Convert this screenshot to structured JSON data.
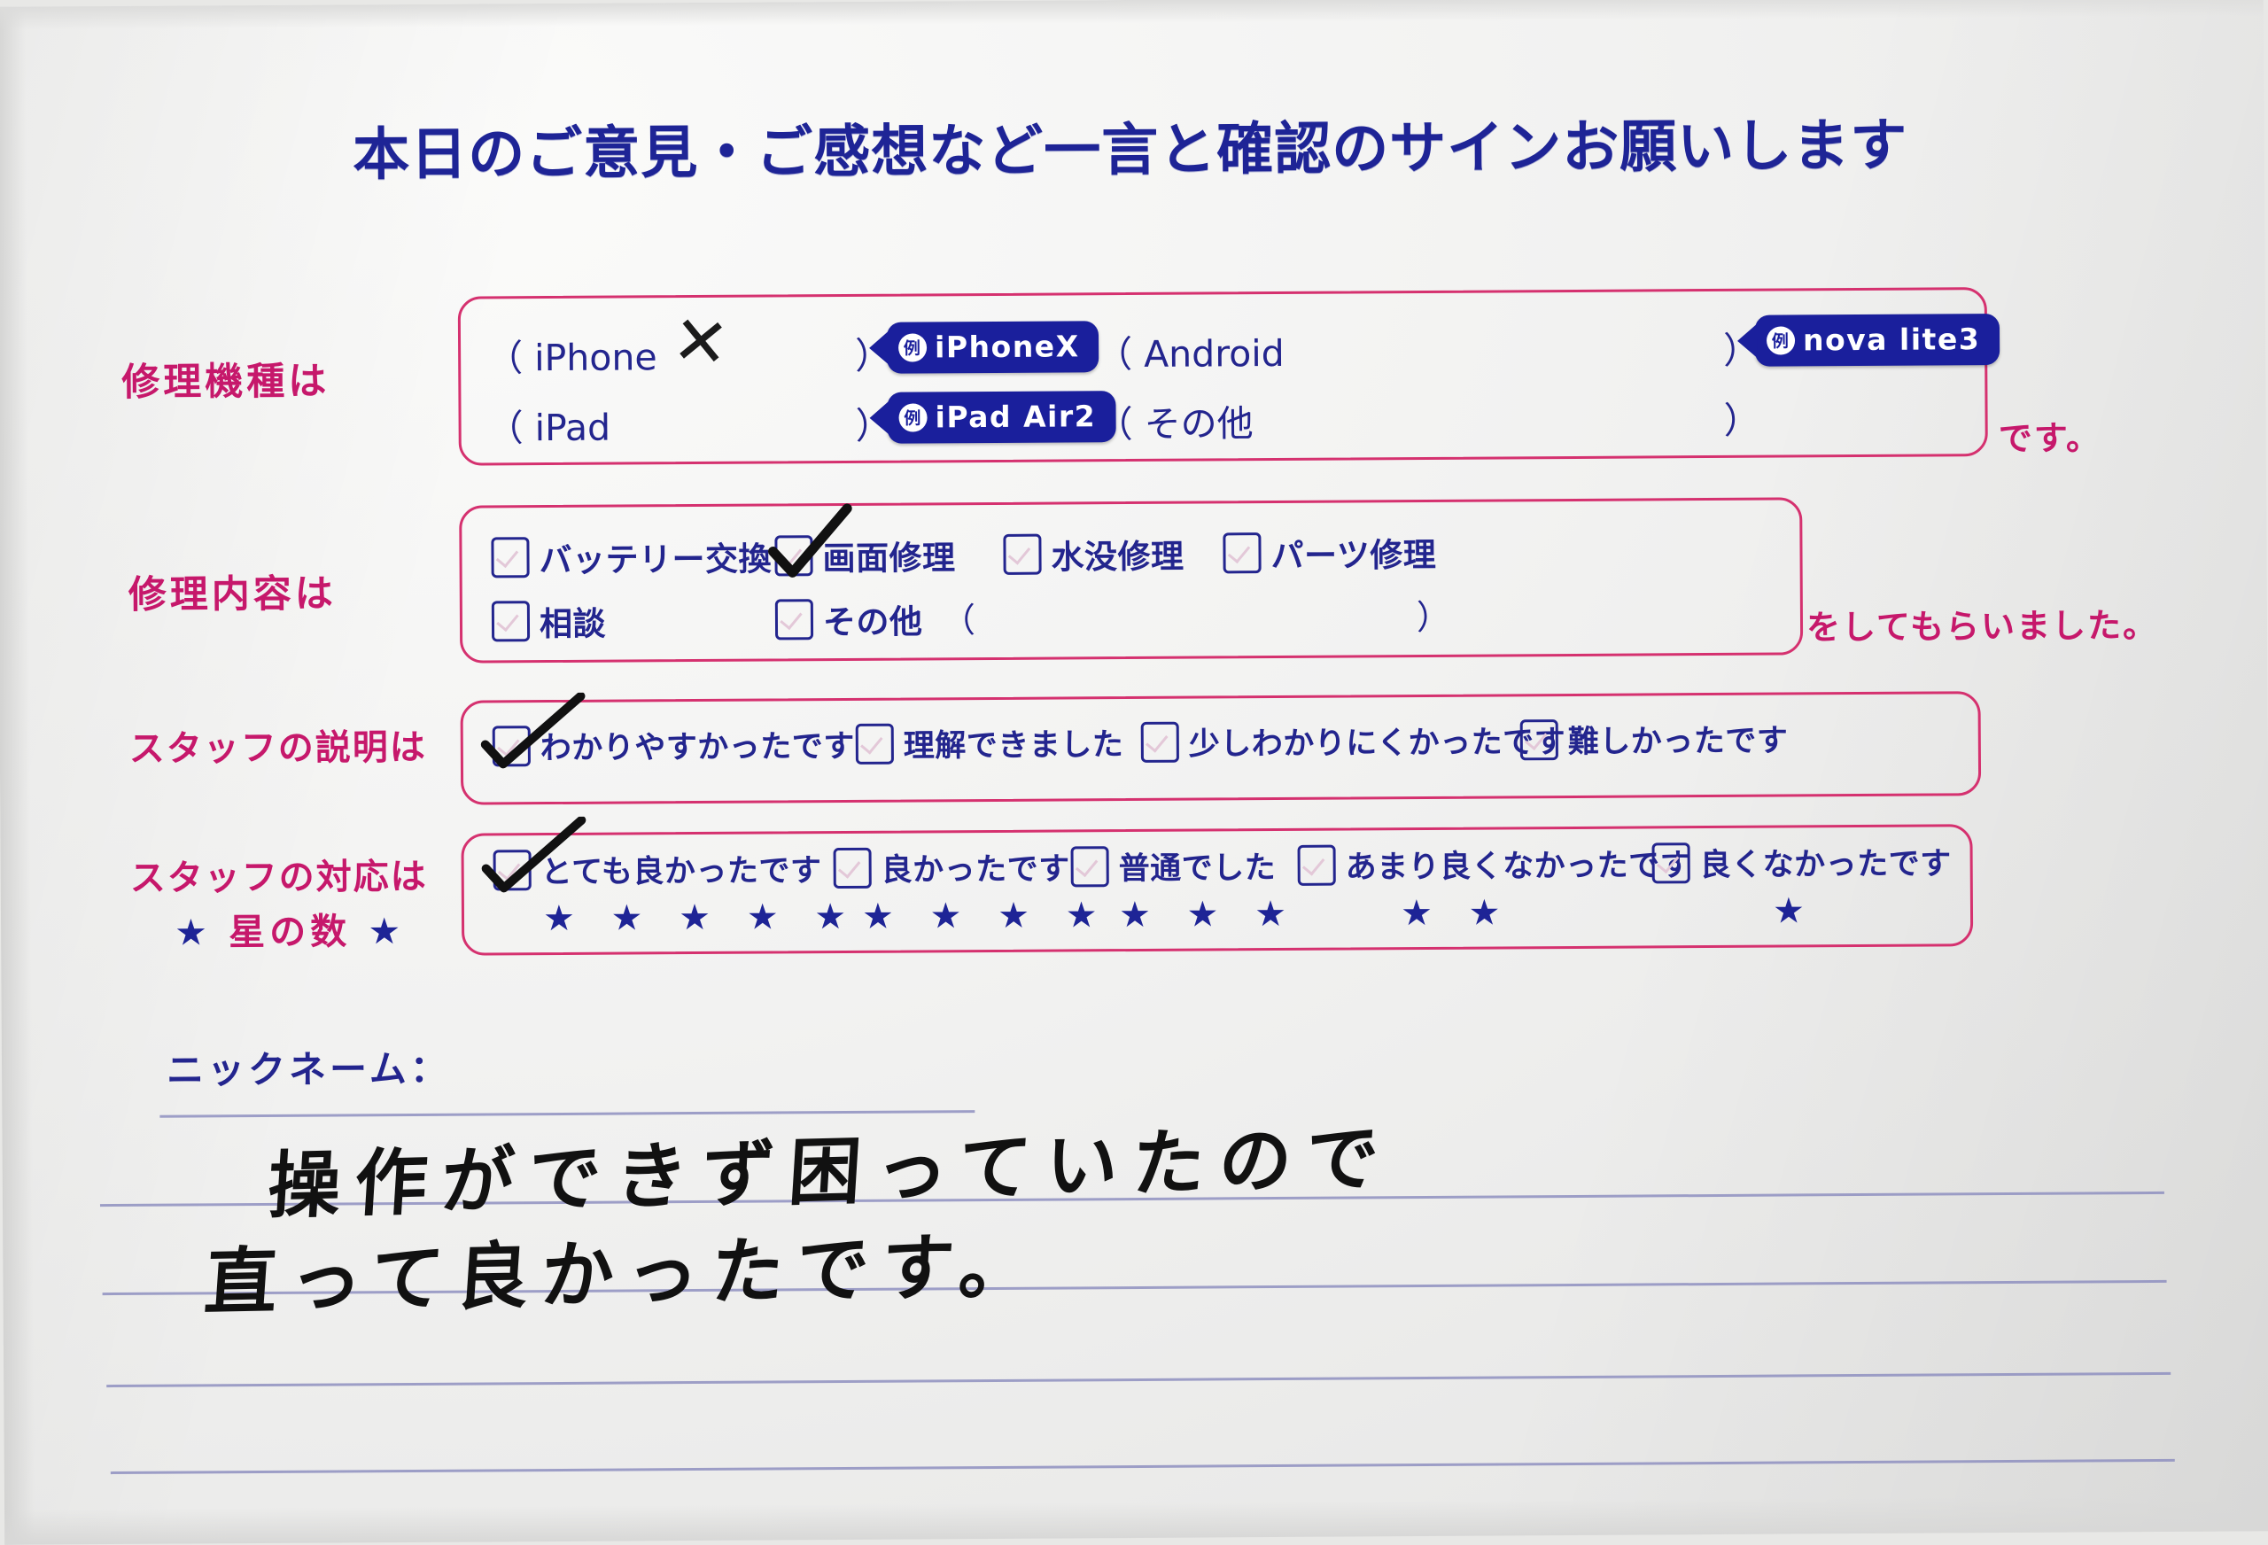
{
  "title": "本日のご意見・ご感想など一言と確認のサインお願いします",
  "sections": {
    "device": {
      "label": "修理機種は",
      "tail": "です。",
      "options": [
        {
          "open": "（ iPhone",
          "close": "）",
          "marked": true,
          "mark": "✕"
        },
        {
          "open": "（ iPad",
          "close": "）",
          "marked": false,
          "mark": ""
        },
        {
          "open": "（ Android",
          "close": "）",
          "marked": false,
          "mark": ""
        },
        {
          "open": "（ その他",
          "close": "）",
          "marked": false,
          "mark": ""
        }
      ],
      "stickers": [
        {
          "badge": "例",
          "text": "iPhoneX"
        },
        {
          "badge": "例",
          "text": "iPad Air2"
        },
        {
          "badge": "例",
          "text": "nova lite3"
        }
      ]
    },
    "repair": {
      "label": "修理内容は",
      "tail": "をしてもらいました。",
      "options": [
        {
          "text": "バッテリー交換",
          "checked": false
        },
        {
          "text": "画面修理",
          "checked": true
        },
        {
          "text": "水没修理",
          "checked": false
        },
        {
          "text": "パーツ修理",
          "checked": false
        },
        {
          "text": "相談",
          "checked": false
        },
        {
          "text": "その他",
          "checked": false
        }
      ],
      "other_open": "（",
      "other_close": "）"
    },
    "explanation": {
      "label": "スタッフの説明は",
      "options": [
        {
          "text": "わかりやすかったです",
          "checked": true
        },
        {
          "text": "理解できました",
          "checked": false
        },
        {
          "text": "少しわかりにくかったです",
          "checked": false
        },
        {
          "text": "難しかったです",
          "checked": false
        }
      ]
    },
    "response": {
      "label": "スタッフの対応は",
      "star_label_left": "★",
      "star_label_text": "星の数",
      "star_label_right": "★",
      "options": [
        {
          "text": "とても良かったです",
          "checked": true,
          "stars": "★ ★ ★ ★ ★"
        },
        {
          "text": "良かったです",
          "checked": false,
          "stars": "★ ★ ★ ★"
        },
        {
          "text": "普通でした",
          "checked": false,
          "stars": "★ ★ ★"
        },
        {
          "text": "あまり良くなかったです",
          "checked": false,
          "stars": "★ ★"
        },
        {
          "text": "良くなかったです",
          "checked": false,
          "stars": "★"
        }
      ]
    },
    "comment": {
      "nickname_label": "ニックネーム：",
      "nickname_value": "",
      "handwriting_line1": "操作ができず困っていたので",
      "handwriting_line2": "直って良かったです。"
    }
  },
  "colors": {
    "title_blue": "#1e2496",
    "label_pink": "#c6186b",
    "box_pink": "#d5316f",
    "sticker_blue": "#1a1f9c",
    "ink_black": "#111111",
    "rule_purple": "#8e8fc0"
  }
}
